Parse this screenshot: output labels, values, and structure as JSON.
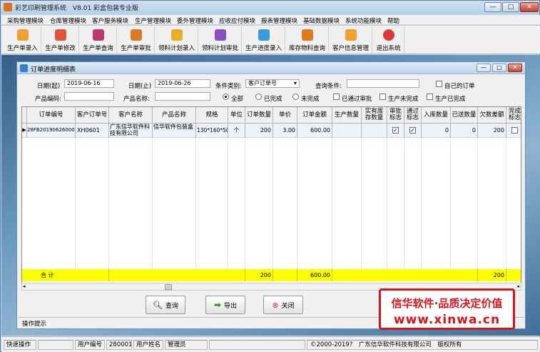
{
  "window": {
    "title": "彩艺印刷管理系统　V8.01 彩盒包装专业版",
    "min": "—",
    "max": "□",
    "close": "✕"
  },
  "menu": [
    "采购管理模块",
    "仓库管理模块",
    "客户服务模块",
    "生产管理模块",
    "委外管理模块",
    "应收应付模块",
    "报表管理模块",
    "基础数据模块",
    "系统功能模块",
    "帮助"
  ],
  "toolbar": [
    {
      "label": "生产单录入",
      "icon": "order-entry-icon",
      "color": "#f0a030"
    },
    {
      "label": "生产单修改",
      "icon": "order-edit-icon",
      "color": "#e0553a"
    },
    {
      "label": "生产单查询",
      "icon": "order-query-icon",
      "color": "#c0396b"
    },
    {
      "label": "生产单审批",
      "icon": "order-approve-icon",
      "color": "#d87a2a"
    },
    {
      "label": "领料计划录入",
      "icon": "material-plan-icon",
      "color": "#e8b020"
    },
    {
      "label": "领料计划审批",
      "icon": "material-approve-icon",
      "color": "#8a4fc0"
    },
    {
      "label": "生产进度录入",
      "icon": "progress-entry-icon",
      "color": "#3a9bd8"
    },
    {
      "label": "库存物料查询",
      "icon": "inventory-query-icon",
      "color": "#e07a20"
    },
    {
      "label": "客户信息管理",
      "icon": "customer-info-icon",
      "color": "#f0a030"
    },
    {
      "label": "退出系统",
      "icon": "exit-icon",
      "color": "#d83a3a"
    }
  ],
  "child_window": {
    "title": "订单进度明细表",
    "min": "—",
    "max": "□",
    "close": "✕"
  },
  "filters": {
    "date_start_label": "日期(起)",
    "date_start": "2019-06-16",
    "date_end_label": "日期(止)",
    "date_end": "2019-06-26",
    "condition_type_label": "条件类别:",
    "condition_type": "客户订单号",
    "query_cond_label": "查询条件:",
    "query_cond": "",
    "my_orders_label": "自己的订单",
    "product_code_label": "产品编码:",
    "product_code": "",
    "product_name_label": "产品名称:",
    "product_name": "",
    "radios": [
      {
        "label": "全部",
        "checked": true
      },
      {
        "label": "已完成",
        "checked": false
      },
      {
        "label": "未完成",
        "checked": false
      }
    ],
    "checks": [
      {
        "label": "已通过审批"
      },
      {
        "label": "生产未完成"
      },
      {
        "label": "生产已完成"
      }
    ]
  },
  "table": {
    "headers": [
      "订单编号",
      "客户订单号",
      "客户名称",
      "产品名称",
      "规格",
      "单位",
      "订单数量",
      "单价",
      "订单金额",
      "生产数量",
      "实有库存数量",
      "审批标志",
      "通过标志",
      "入库数量",
      "已送数量",
      "欠数差额",
      "完成标志"
    ],
    "rows": [
      {
        "order_no": "28FB201906260001",
        "cust_order": "XH0601",
        "customer": "广东信华软件科技有限公司",
        "product": "信华软件包装盒",
        "spec": "130*160*50",
        "unit": "个",
        "qty": "200",
        "price": "3.00",
        "amount": "600.00",
        "prod_qty": "",
        "stock_qty": "",
        "approve_flag": true,
        "pass_flag": true,
        "in_qty": "0",
        "sent_qty": "0",
        "diff": "200",
        "done_flag": false
      }
    ],
    "totals": {
      "label": "合  计",
      "qty": "200",
      "amount": "600.00",
      "diff": "200"
    }
  },
  "buttons": {
    "query": "查询",
    "export": "导出",
    "close": "关闭"
  },
  "tip_label": "操作提示",
  "status": {
    "quick_label": "快速操作",
    "user_no_label": "用户编号",
    "user_no": "280001",
    "user_name_label": "用户姓名",
    "user_name": "管理员",
    "copyright": "©2000-2019?　广东信华软件科技有限公司　版权所有"
  },
  "ad": {
    "line1": "信华软件·品质决定价值",
    "line2": "www.xinwa.cn"
  },
  "colors": {
    "total_row": "#ffff00",
    "ad_red": "#d8131b",
    "selected_row": "#eaf2fb"
  }
}
